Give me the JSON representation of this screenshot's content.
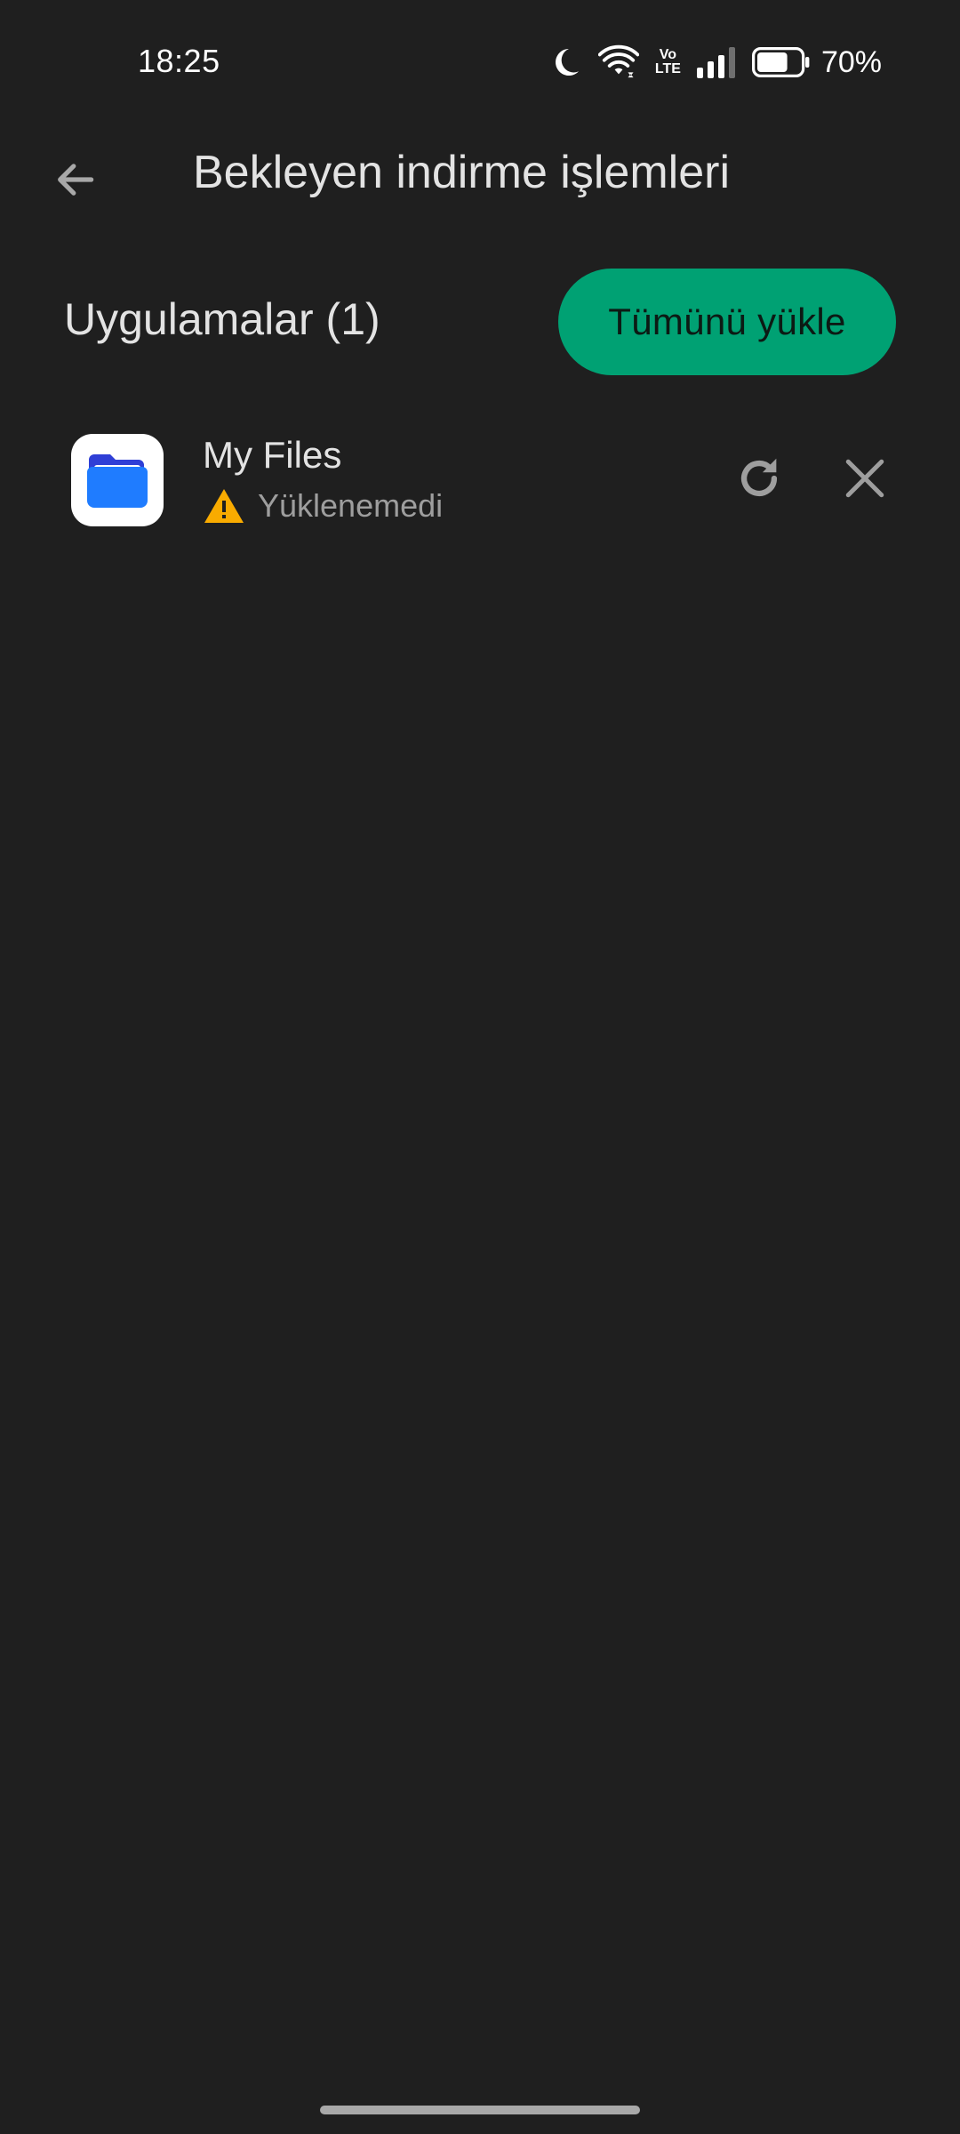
{
  "status_bar": {
    "time": "18:25",
    "battery_percent": "70%",
    "battery_level": 0.7,
    "icons": [
      "moon-icon",
      "wifi-icon",
      "volte-icon",
      "signal-icon",
      "battery-icon"
    ],
    "volte_top": "Vo",
    "volte_bottom": "LTE"
  },
  "app_bar": {
    "title": "Bekleyen indirme işlemleri",
    "back_icon": "arrow-back-icon"
  },
  "section": {
    "title": "Uygulamalar (1)",
    "install_all_label": "Tümünü yükle",
    "install_all_color": "#00a173"
  },
  "apps": [
    {
      "name": "My Files",
      "status": "Yüklenemedi",
      "status_icon": "warning-icon",
      "status_icon_color": "#f9ab00",
      "icon": "folder-icon",
      "actions": [
        "retry-icon",
        "close-icon"
      ]
    }
  ],
  "colors": {
    "background": "#1f1f1f",
    "text_primary": "#e3e3e3",
    "text_secondary": "#9e9e9e",
    "accent": "#00a173"
  }
}
